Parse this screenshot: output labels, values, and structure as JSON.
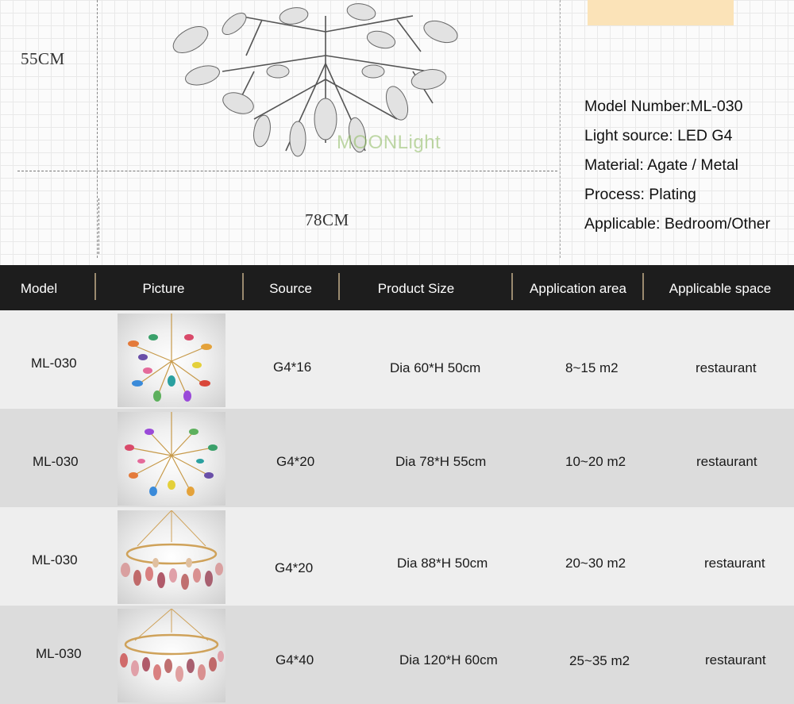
{
  "drawing": {
    "height_label": "55CM",
    "width_label": "78CM",
    "watermark": "MOONLight"
  },
  "specs": [
    "Model Number:ML-030",
    "Light source: LED G4",
    "Material: Agate / Metal",
    "Process: Plating",
    "Applicable: Bedroom/Other"
  ],
  "table": {
    "headers": [
      "Model",
      "Picture",
      "Source",
      "Product Size",
      "Application area",
      "Applicable space"
    ],
    "rows": [
      {
        "model": "ML-030",
        "source": "G4*16",
        "size": "Dia 60*H 50cm",
        "area": "8~15 m2",
        "space": "restaurant",
        "picture": "branch-chandelier-photo"
      },
      {
        "model": "ML-030",
        "source": "G4*20",
        "size": "Dia 78*H 55cm",
        "area": "10~20 m2",
        "space": "restaurant",
        "picture": "branch-chandelier-photo"
      },
      {
        "model": "ML-030",
        "source": "G4*20",
        "size": "Dia 88*H 50cm",
        "area": "20~30 m2",
        "space": "restaurant",
        "picture": "ring-chandelier-photo"
      },
      {
        "model": "ML-030",
        "source": "G4*40",
        "size": "Dia 120*H 60cm",
        "area": "25~35 m2",
        "space": "restaurant",
        "picture": "ring-chandelier-photo"
      }
    ]
  },
  "colors": {
    "header_bg": "#1d1d1d",
    "separator": "#9a8a6f",
    "row_light": "#eeeeee",
    "row_dark": "#dcdcdc",
    "swatch": "#fbe3b8"
  }
}
